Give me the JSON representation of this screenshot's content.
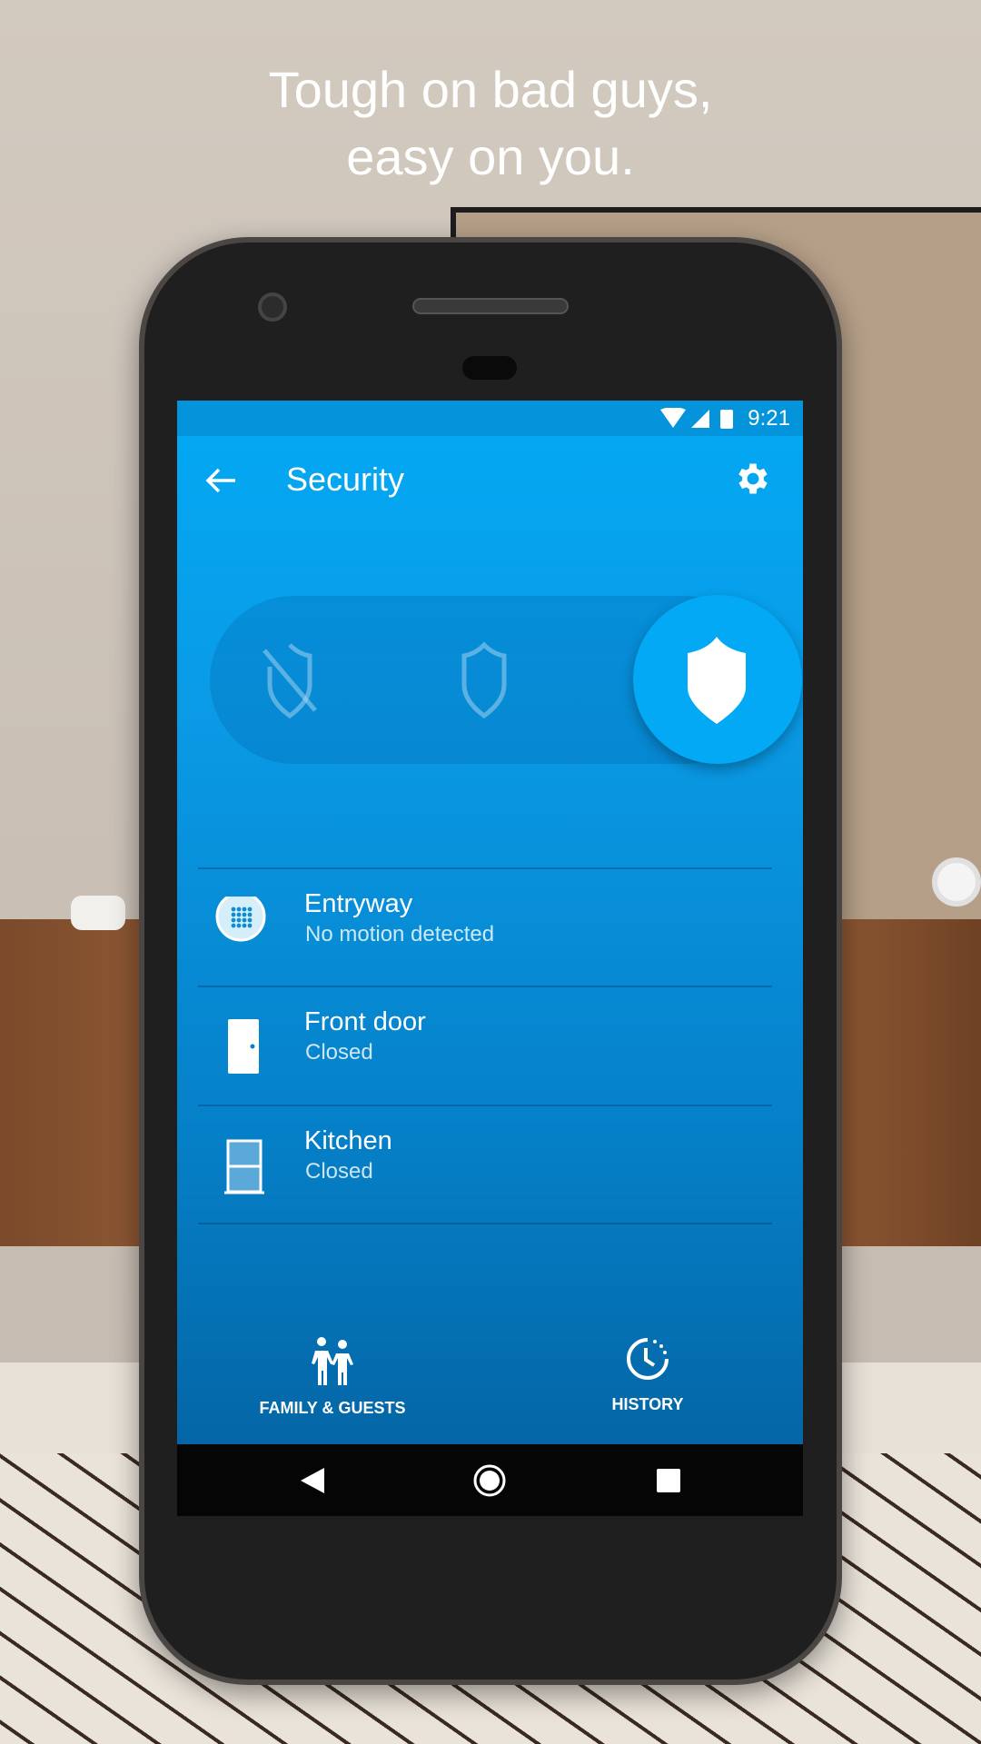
{
  "headline": {
    "line1": "Tough on bad guys,",
    "line2": "easy on you."
  },
  "status_bar": {
    "time": "9:21",
    "icons": [
      "wifi-icon",
      "signal-icon",
      "battery-icon"
    ]
  },
  "toolbar": {
    "title": "Security",
    "back_icon": "arrow-left-icon",
    "settings_icon": "gear-icon"
  },
  "security_mode": {
    "options": [
      "off",
      "home",
      "away"
    ],
    "selected": "away"
  },
  "sensors": [
    {
      "name": "Entryway",
      "status": "No motion detected",
      "icon": "motion-sensor-icon"
    },
    {
      "name": "Front door",
      "status": "Closed",
      "icon": "door-icon"
    },
    {
      "name": "Kitchen",
      "status": "Closed",
      "icon": "window-icon"
    }
  ],
  "bottom_nav": [
    {
      "label": "FAMILY & GUESTS",
      "icon": "family-icon"
    },
    {
      "label": "HISTORY",
      "icon": "history-icon"
    }
  ],
  "colors": {
    "accent": "#03a9f4",
    "primary_dark": "#0466a6"
  }
}
